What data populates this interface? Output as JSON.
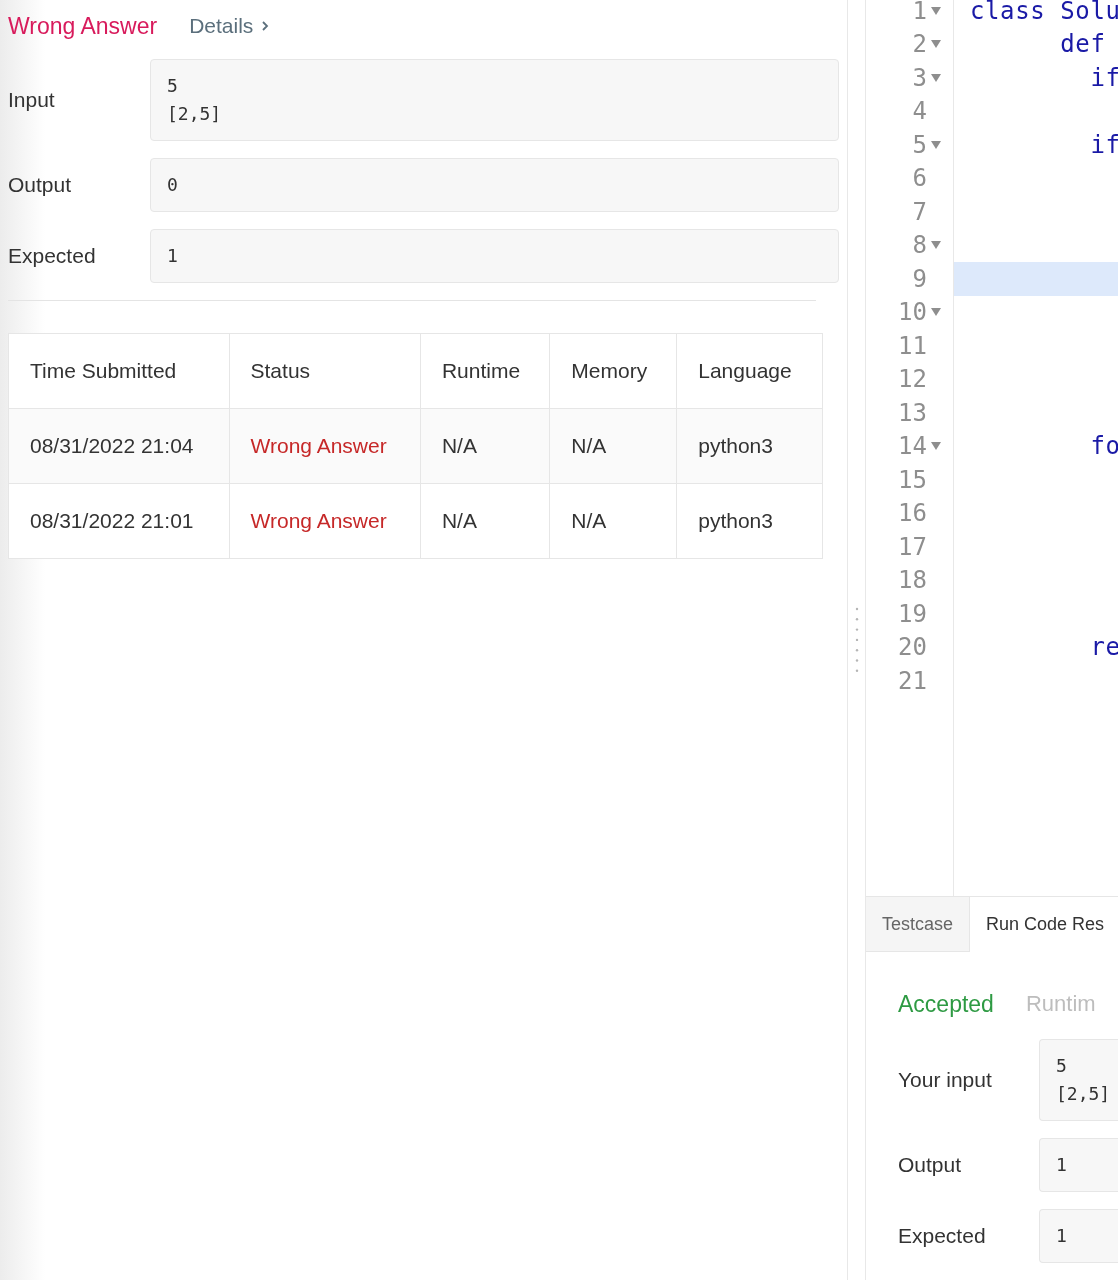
{
  "submission_result": {
    "passed": false,
    "title": "Wrong Answer",
    "details_link": "Details"
  },
  "fields": [
    {
      "label": "Input",
      "value": "5\n[2,5]"
    },
    {
      "label": "Output",
      "value": "0"
    },
    {
      "label": "Expected",
      "value": "1"
    }
  ],
  "submissions_table": {
    "columns": [
      "Time Submitted",
      "Status",
      "Runtime",
      "Memory",
      "Language"
    ],
    "rows": [
      {
        "time": "08/31/2022 21:04",
        "status": "Wrong Answer",
        "passed": false,
        "runtime": "N/A",
        "memory": "N/A",
        "language": "python3"
      },
      {
        "time": "08/31/2022 21:01",
        "status": "Wrong Answer",
        "passed": false,
        "runtime": "N/A",
        "memory": "N/A",
        "language": "python3"
      }
    ]
  },
  "editor": {
    "lines": [
      {
        "number": "1",
        "foldable": true,
        "active": false,
        "code": "class Solu"
      },
      {
        "number": "2",
        "foldable": true,
        "active": false,
        "code": "      def"
      },
      {
        "number": "3",
        "foldable": true,
        "active": false,
        "code": "        if"
      },
      {
        "number": "4",
        "foldable": false,
        "active": false
      },
      {
        "number": "5",
        "foldable": true,
        "active": false,
        "code": "        if"
      },
      {
        "number": "6",
        "foldable": false,
        "active": false
      },
      {
        "number": "7",
        "foldable": false,
        "active": false
      },
      {
        "number": "8",
        "foldable": true,
        "active": false
      },
      {
        "number": "9",
        "foldable": false,
        "active": true
      },
      {
        "number": "10",
        "foldable": true,
        "active": false
      },
      {
        "number": "11",
        "foldable": false,
        "active": false
      },
      {
        "number": "12",
        "foldable": false,
        "active": false
      },
      {
        "number": "13",
        "foldable": false,
        "active": false
      },
      {
        "number": "14",
        "foldable": true,
        "active": false,
        "code": "        fo"
      },
      {
        "number": "15",
        "foldable": false,
        "active": false
      },
      {
        "number": "16",
        "foldable": false,
        "active": false
      },
      {
        "number": "17",
        "foldable": false,
        "active": false
      },
      {
        "number": "18",
        "foldable": false,
        "active": false
      },
      {
        "number": "19",
        "foldable": false,
        "active": false
      },
      {
        "number": "20",
        "foldable": false,
        "active": false,
        "code": "        re"
      },
      {
        "number": "21",
        "foldable": false,
        "active": false
      }
    ]
  },
  "console": {
    "tabs": [
      {
        "label": "Testcase",
        "selected": false
      },
      {
        "label": "Run Code Res",
        "selected": true
      }
    ],
    "result": {
      "passed": true,
      "title": "Accepted",
      "runtime_label": "Runtim"
    },
    "fields": [
      {
        "label": "Your input",
        "value": "5\n[2,5]"
      },
      {
        "label": "Output",
        "value": "1"
      },
      {
        "label": "Expected",
        "value": "1"
      }
    ]
  }
}
